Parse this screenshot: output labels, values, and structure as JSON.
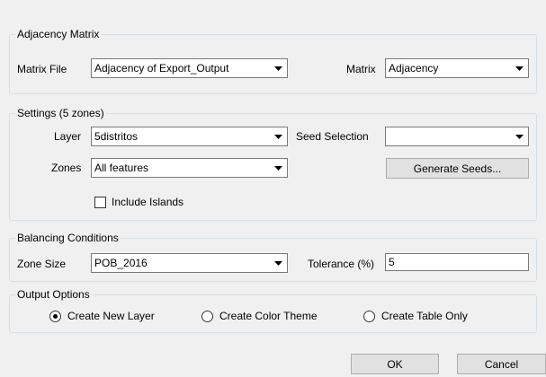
{
  "adjacency": {
    "title": "Adjacency Matrix",
    "matrix_file_label": "Matrix File",
    "matrix_file_value": "Adjacency of Export_Output",
    "matrix_label": "Matrix",
    "matrix_value": "Adjacency"
  },
  "settings": {
    "title": "Settings (5 zones)",
    "layer_label": "Layer",
    "layer_value": "5distritos",
    "seed_selection_label": "Seed Selection",
    "seed_selection_value": "",
    "zones_label": "Zones",
    "zones_value": "All features",
    "generate_seeds_label": "Generate Seeds...",
    "include_islands_label": "Include Islands",
    "include_islands_checked": false
  },
  "balancing": {
    "title": "Balancing Conditions",
    "zone_size_label": "Zone Size",
    "zone_size_value": "POB_2016",
    "tolerance_label": "Tolerance (%)",
    "tolerance_value": "5"
  },
  "output": {
    "title": "Output Options",
    "options": [
      {
        "label": "Create New Layer",
        "selected": true
      },
      {
        "label": "Create Color Theme",
        "selected": false
      },
      {
        "label": "Create Table Only",
        "selected": false
      }
    ]
  },
  "buttons": {
    "ok_label": "OK",
    "cancel_label": "Cancel"
  },
  "icons": {
    "dropdown": "chevron-down-icon",
    "radio": "radio-button",
    "checkbox": "checkbox"
  }
}
